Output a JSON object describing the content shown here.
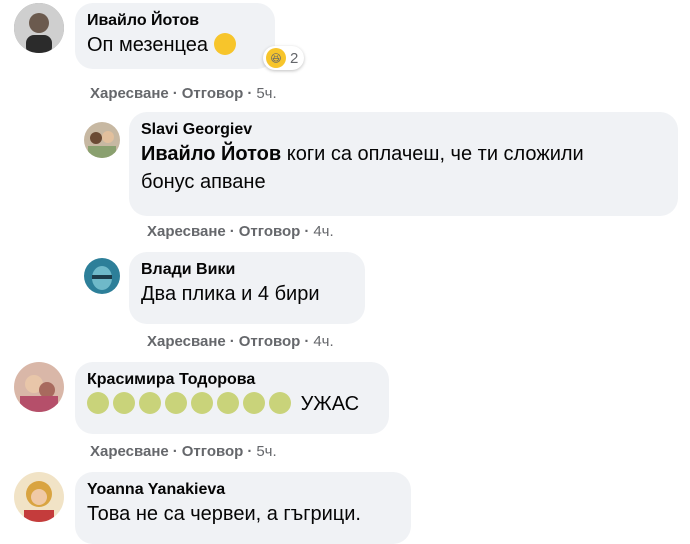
{
  "comments": [
    {
      "author": "Ивайло Йотов",
      "text": "Оп мезенцеа",
      "reaction_count": "2",
      "actions": {
        "like": "Харесване",
        "reply": "Отговор",
        "time": "5ч."
      },
      "avatar_color": "#7a7a7a"
    },
    {
      "author": "Slavi Georgiev",
      "mention": "Ивайло Йотов",
      "text": " коги са оплачеш, че ти сложили",
      "text_line2": "бонус апване",
      "actions": {
        "like": "Харесване",
        "reply": "Отговор",
        "time": "4ч."
      },
      "avatar_color": "#b3a28c"
    },
    {
      "author": "Влади Вики",
      "text": "Два плика и 4 бири",
      "actions": {
        "like": "Харесване",
        "reply": "Отговор",
        "time": "4ч."
      },
      "avatar_color": "#3f8fa8"
    },
    {
      "author": "Красимира Тодорова",
      "text": "УЖАС",
      "emoji_count": 8,
      "actions": {
        "like": "Харесване",
        "reply": "Отговор",
        "time": "5ч."
      },
      "avatar_color": "#b88a8a"
    },
    {
      "author": "Yoanna Yanakieva",
      "text": "Това не са червеи, а гъгрици.",
      "actions": {
        "like": "",
        "reply": "",
        "time": ""
      },
      "avatar_color": "#d9a441"
    }
  ],
  "separator": "·",
  "icons": {
    "reaction": "laughing-emoji",
    "grin": "grinning-emoji",
    "sick": "vomiting-emoji"
  }
}
